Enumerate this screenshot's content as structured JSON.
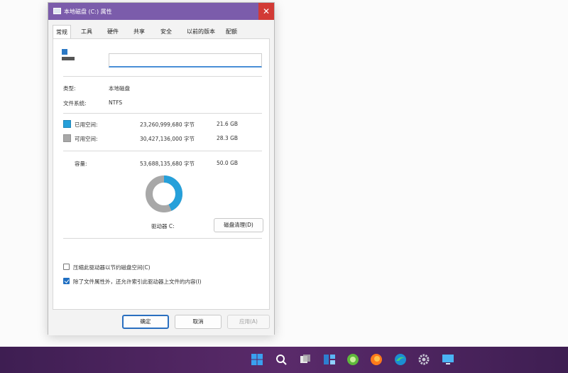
{
  "window": {
    "title": "本地磁盘 (C:) 属性",
    "close_glyph": "✕"
  },
  "tabs": [
    "常规",
    "工具",
    "硬件",
    "共享",
    "安全",
    "以前的版本",
    "配额"
  ],
  "general": {
    "drive_name_value": "",
    "type_label": "类型:",
    "type_value": "本地磁盘",
    "fs_label": "文件系统:",
    "fs_value": "NTFS",
    "used": {
      "label": "已用空间:",
      "bytes": "23,260,999,680 字节",
      "size": "21.6 GB",
      "color": "#26a0da"
    },
    "free": {
      "label": "可用空间:",
      "bytes": "30,427,136,000 字节",
      "size": "28.3 GB",
      "color": "#a8a8a8"
    },
    "capacity": {
      "label": "容量:",
      "bytes": "53,688,135,680 字节",
      "size": "50.0 GB"
    },
    "used_fraction": 0.432,
    "drive_label": "驱动器 C:",
    "cleanup_button": "磁盘清理(D)",
    "compress_option": {
      "label": "压缩此驱动器以节约磁盘空间(C)",
      "checked": false
    },
    "index_option": {
      "label": "除了文件属性外，还允许索引此驱动器上文件的内容(I)",
      "checked": true
    }
  },
  "footer": {
    "ok": "确定",
    "cancel": "取消",
    "apply": "应用(A)"
  },
  "taskbar": {
    "icons": [
      "start-icon",
      "search-icon",
      "task-view-icon",
      "widgets-icon",
      "chat-icon",
      "firefox-icon",
      "edge-icon",
      "settings-icon",
      "explorer-icon"
    ]
  }
}
